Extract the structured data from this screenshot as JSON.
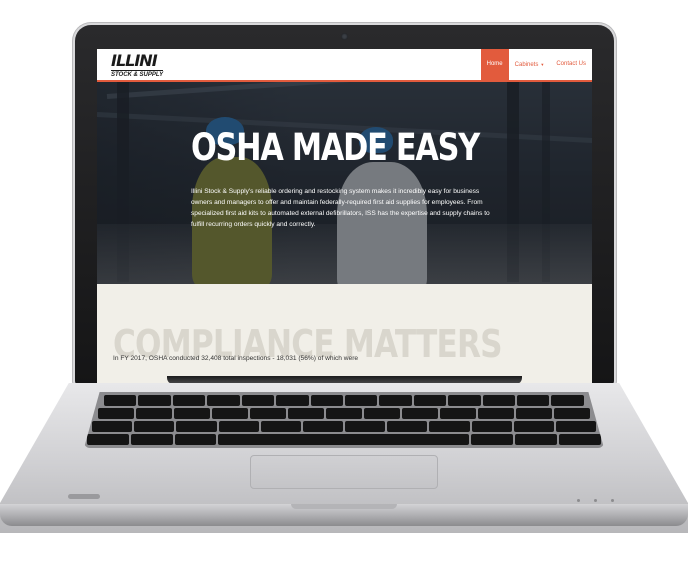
{
  "site": {
    "logo": {
      "main": "ILLINI",
      "sub": "STOCK & SUPPLY"
    },
    "nav": [
      {
        "label": "Home",
        "active": true
      },
      {
        "label": "Cabinets",
        "dropdown": true
      },
      {
        "label": "Contact Us"
      }
    ],
    "hero": {
      "title": "OSHA MADE EASY",
      "text": "Illini Stock & Supply's reliable ordering and restocking system makes it incredibly easy for business owners and managers to offer and maintain federally-required first aid supplies for employees. From specialized first aid kits to automated external defibrillators, ISS has the expertise and supply chains to fulfill recurring orders quickly and correctly."
    },
    "compliance": {
      "title": "COMPLIANCE MATTERS",
      "text": "In FY 2017, OSHA conducted 32,408 total inspections - 18,031 (56%) of which were"
    }
  },
  "icons": {
    "caret": "chevron-down-icon",
    "camera": "webcam-icon"
  },
  "colors": {
    "accent": "#e25b3d",
    "hero_text": "#ffffff",
    "section_bg": "#f1efe8",
    "section_title": "#d9d6cd"
  }
}
